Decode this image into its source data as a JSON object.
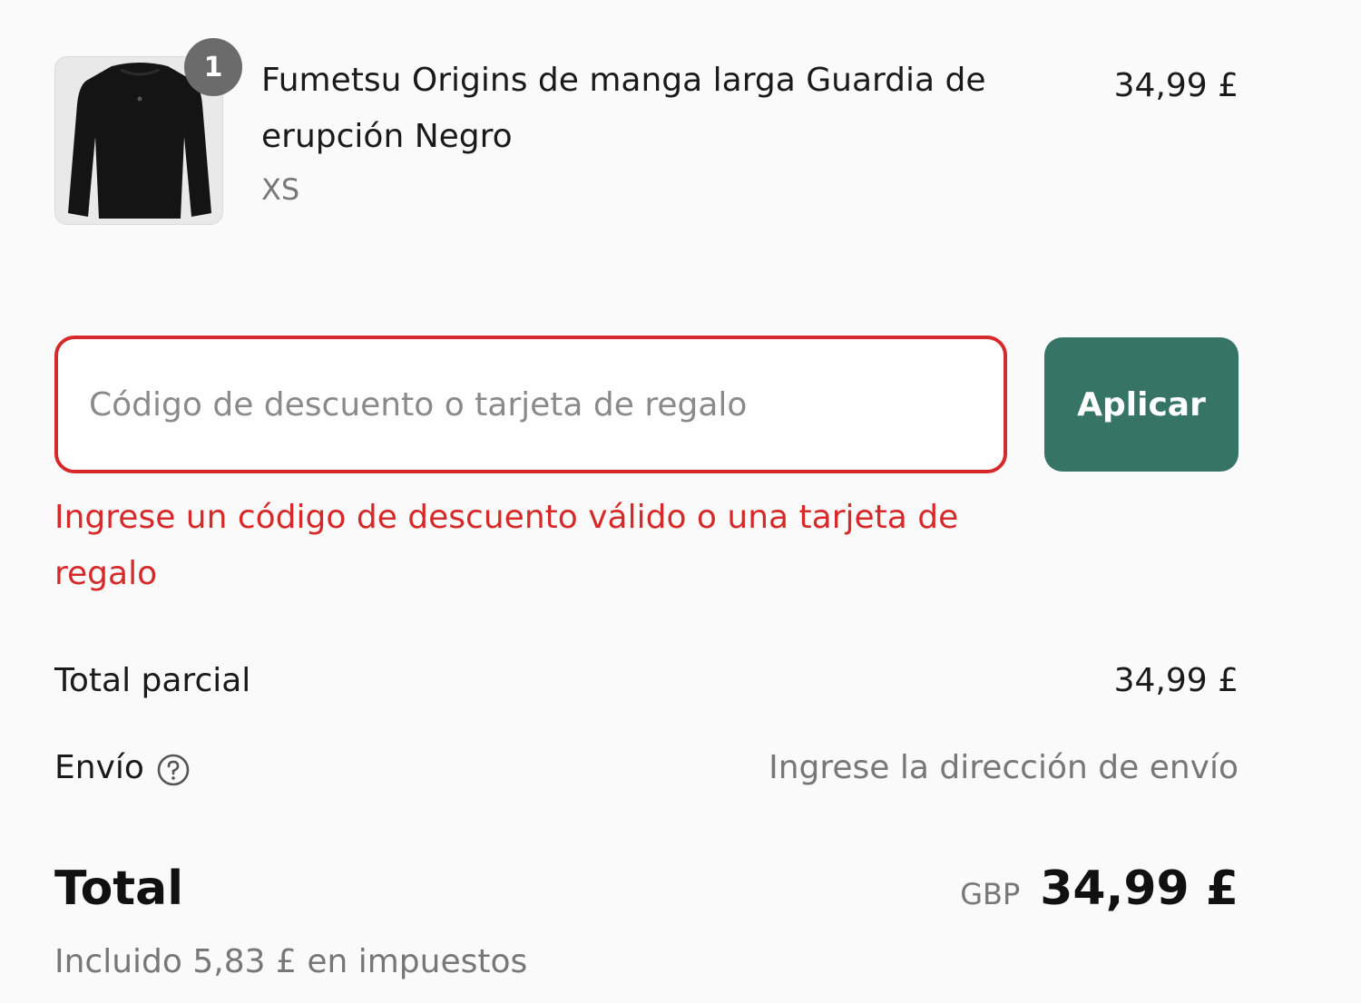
{
  "product": {
    "quantity": "1",
    "name": "Fumetsu Origins de manga larga Guardia de erupción Negro",
    "variant": "XS",
    "price": "34,99 £",
    "thumbnail_icon": "long-sleeve-shirt-icon"
  },
  "discount": {
    "input_value": "",
    "placeholder": "Código de descuento o tarjeta de regalo",
    "apply_label": "Aplicar",
    "error": "Ingrese un código de descuento válido o una tarjeta de regalo"
  },
  "totals": {
    "subtotal_label": "Total parcial",
    "subtotal_value": "34,99 £",
    "shipping_label": "Envío",
    "shipping_value": "Ingrese la dirección de envío",
    "total_label": "Total",
    "currency": "GBP",
    "total_value": "34,99 £",
    "tax_note": "Incluido 5,83 £ en impuestos"
  },
  "colors": {
    "accent_button": "#367565",
    "error": "#d62a2a",
    "badge": "#6b6b6b",
    "muted_text": "#777777"
  }
}
